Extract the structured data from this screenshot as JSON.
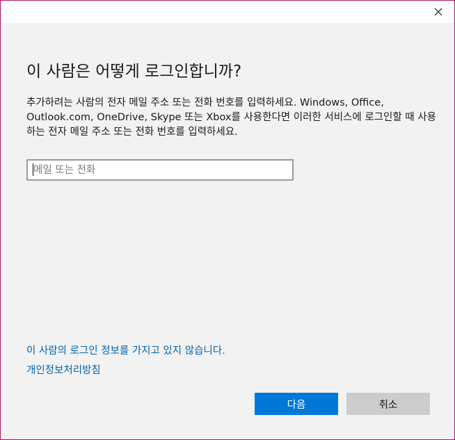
{
  "colors": {
    "accent": "#0078d7",
    "link": "#0063b1",
    "window_border": "#b4125f",
    "background": "#f2f2f2"
  },
  "titlebar": {
    "close_icon": "close-icon"
  },
  "dialog": {
    "heading": "이 사람은 어떻게 로그인합니까?",
    "description": "추가하려는 사람의 전자 메일 주소 또는 전화 번호를 입력하세요. Windows, Office, Outlook.com, OneDrive, Skype 또는 Xbox를 사용한다면 이러한 서비스에 로그인할 때 사용하는 전자 메일 주소 또는 전화 번호를 입력하세요.",
    "input": {
      "placeholder": "메일 또는 전화",
      "value": ""
    },
    "links": {
      "no_account": "이 사람의 로그인 정보를 가지고 있지 않습니다.",
      "privacy": "개인정보처리방침"
    },
    "buttons": {
      "next": "다음",
      "cancel": "취소"
    }
  }
}
